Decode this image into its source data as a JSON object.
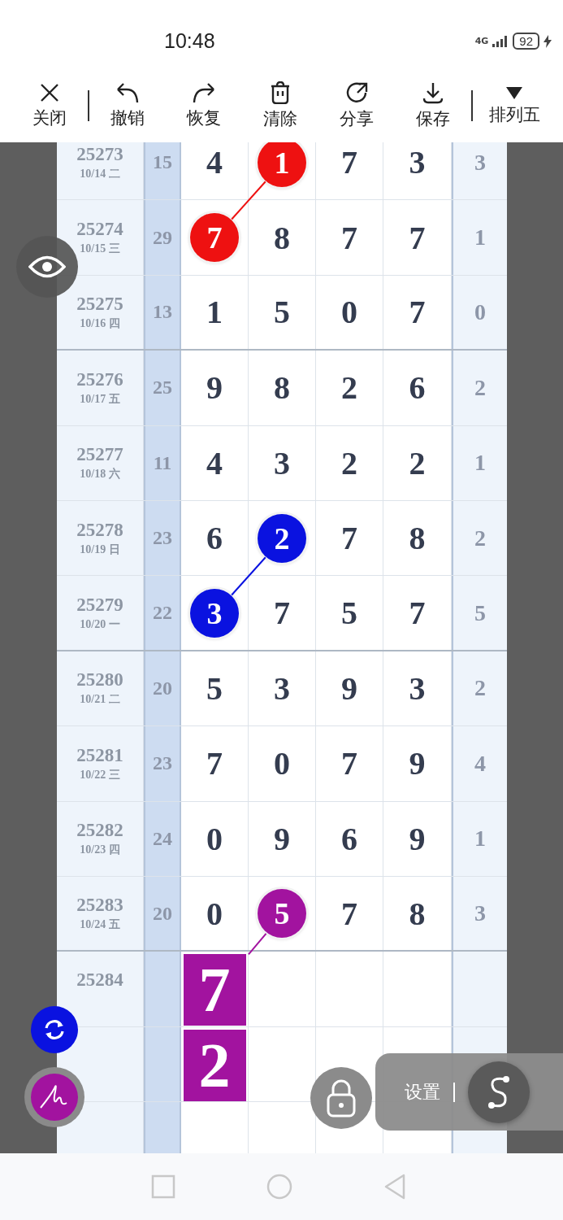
{
  "status_bar": {
    "time": "10:48",
    "network": "4G",
    "battery": "92"
  },
  "toolbar": [
    {
      "kind": "close",
      "label": "关闭"
    },
    {
      "kind": "separator"
    },
    {
      "kind": "undo",
      "label": "撤销"
    },
    {
      "kind": "redo",
      "label": "恢复"
    },
    {
      "kind": "clear",
      "label": "清除"
    },
    {
      "kind": "share",
      "label": "分享"
    },
    {
      "kind": "save",
      "label": "保存"
    },
    {
      "kind": "separator"
    },
    {
      "kind": "dropdown",
      "label": "排列五"
    }
  ],
  "rows": [
    {
      "issue": "25273",
      "date": "10/14 二",
      "sum": "15",
      "digits": [
        {
          "text": "4"
        },
        {
          "text": "1",
          "color": "#ee1111"
        },
        {
          "text": "7"
        },
        {
          "text": "3"
        }
      ],
      "span": "3",
      "divider_below": false
    },
    {
      "issue": "25274",
      "date": "10/15 三",
      "sum": "29",
      "digits": [
        {
          "text": "7",
          "color": "#ee1111"
        },
        {
          "text": "8"
        },
        {
          "text": "7"
        },
        {
          "text": "7"
        }
      ],
      "span": "1",
      "divider_below": false
    },
    {
      "issue": "25275",
      "date": "10/16 四",
      "sum": "13",
      "digits": [
        {
          "text": "1"
        },
        {
          "text": "5"
        },
        {
          "text": "0"
        },
        {
          "text": "7"
        }
      ],
      "span": "0",
      "divider_below": true
    },
    {
      "issue": "25276",
      "date": "10/17 五",
      "sum": "25",
      "digits": [
        {
          "text": "9"
        },
        {
          "text": "8"
        },
        {
          "text": "2"
        },
        {
          "text": "6"
        }
      ],
      "span": "2",
      "divider_below": false
    },
    {
      "issue": "25277",
      "date": "10/18 六",
      "sum": "11",
      "digits": [
        {
          "text": "4"
        },
        {
          "text": "3"
        },
        {
          "text": "2"
        },
        {
          "text": "2"
        }
      ],
      "span": "1",
      "divider_below": false
    },
    {
      "issue": "25278",
      "date": "10/19 日",
      "sum": "23",
      "digits": [
        {
          "text": "6"
        },
        {
          "text": "2",
          "color": "#0a12e0"
        },
        {
          "text": "7"
        },
        {
          "text": "8"
        }
      ],
      "span": "2",
      "divider_below": false
    },
    {
      "issue": "25279",
      "date": "10/20 一",
      "sum": "22",
      "digits": [
        {
          "text": "3",
          "color": "#0a12e0"
        },
        {
          "text": "7"
        },
        {
          "text": "5"
        },
        {
          "text": "7"
        }
      ],
      "span": "5",
      "divider_below": true
    },
    {
      "issue": "25280",
      "date": "10/21 二",
      "sum": "20",
      "digits": [
        {
          "text": "5"
        },
        {
          "text": "3"
        },
        {
          "text": "9"
        },
        {
          "text": "3"
        }
      ],
      "span": "2",
      "divider_below": false
    },
    {
      "issue": "25281",
      "date": "10/22 三",
      "sum": "23",
      "digits": [
        {
          "text": "7"
        },
        {
          "text": "0"
        },
        {
          "text": "7"
        },
        {
          "text": "9"
        }
      ],
      "span": "4",
      "divider_below": false
    },
    {
      "issue": "25282",
      "date": "10/23 四",
      "sum": "24",
      "digits": [
        {
          "text": "0"
        },
        {
          "text": "9"
        },
        {
          "text": "6"
        },
        {
          "text": "9"
        }
      ],
      "span": "1",
      "divider_below": false
    },
    {
      "issue": "25283",
      "date": "10/24 五",
      "sum": "20",
      "digits": [
        {
          "text": "0"
        },
        {
          "text": "5",
          "color": "#a2139f"
        },
        {
          "text": "7"
        },
        {
          "text": "8"
        }
      ],
      "span": "3",
      "divider_below": true
    }
  ],
  "prediction": {
    "issue": "25284",
    "picks": [
      {
        "text": "7",
        "color": "#a2139f"
      },
      {
        "text": "2",
        "color": "#a2139f"
      }
    ]
  },
  "settings_panel": {
    "label": "设置"
  }
}
